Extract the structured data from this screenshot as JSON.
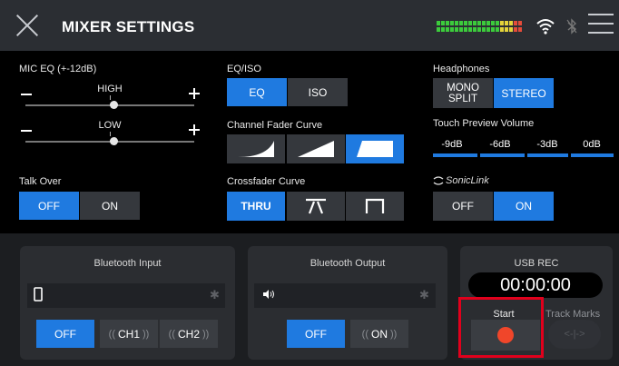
{
  "header": {
    "title": "MIXER SETTINGS"
  },
  "mic_eq": {
    "label": "MIC EQ (+-12dB)",
    "high_label": "HIGH",
    "low_label": "LOW",
    "high_value": 0.5,
    "low_value": 0.5
  },
  "talk_over": {
    "label": "Talk Over",
    "off": "OFF",
    "on": "ON",
    "selected": "OFF"
  },
  "eq_iso": {
    "label": "EQ/ISO",
    "eq": "EQ",
    "iso": "ISO",
    "selected": "EQ"
  },
  "channel_fader_curve": {
    "label": "Channel Fader Curve",
    "selected": 3
  },
  "crossfader_curve": {
    "label": "Crossfader Curve",
    "thru": "THRU",
    "selected": "THRU"
  },
  "headphones": {
    "label": "Headphones",
    "mono_split_line1": "MONO",
    "mono_split_line2": "SPLIT",
    "stereo": "STEREO",
    "selected": "STEREO"
  },
  "touch_preview_volume": {
    "label": "Touch Preview Volume",
    "levels": [
      "-9dB",
      "-6dB",
      "-3dB",
      "0dB"
    ]
  },
  "soniclink": {
    "label": "SonicLink",
    "off": "OFF",
    "on": "ON",
    "selected": "ON"
  },
  "bluetooth_input": {
    "title": "Bluetooth Input",
    "off": "OFF",
    "ch1": "CH1",
    "ch2": "CH2",
    "selected": "OFF"
  },
  "bluetooth_output": {
    "title": "Bluetooth Output",
    "off": "OFF",
    "on": "ON",
    "selected": "OFF"
  },
  "usb_rec": {
    "title": "USB REC",
    "time": "00:00:00",
    "start": "Start",
    "track_marks": "Track Marks"
  },
  "colors": {
    "accent": "#1f7ae0",
    "highlight": "#e1001c",
    "rec": "#f0462a"
  }
}
